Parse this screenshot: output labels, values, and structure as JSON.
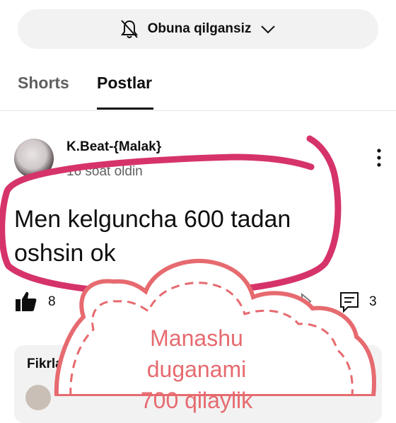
{
  "subscribe": {
    "label": "Obuna qilgansiz",
    "icon": "bell-off-icon",
    "dropdown_icon": "chevron-down-icon"
  },
  "tabs": [
    {
      "label": "Shorts",
      "selected": false
    },
    {
      "label": "Postlar",
      "selected": true
    }
  ],
  "post": {
    "author": "K.Beat-{Malak}",
    "time": "16 soat oldin",
    "text": "Men kelguncha 600 tadan oshsin ok",
    "likes": "8",
    "comments": "3"
  },
  "comments_section": {
    "title": "Fikrlar"
  },
  "sticker": {
    "text": "Manashu duganami 700 qilaylik"
  },
  "colors": {
    "annotation_pink": "#d6336b",
    "cloud_coral": "#e66a6f",
    "pill_bg": "#f2f2f2"
  }
}
